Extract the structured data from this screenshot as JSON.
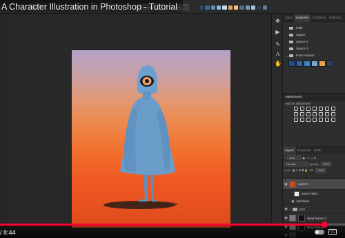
{
  "video": {
    "title": "A Character Illustration in Photoshop - Tutorial",
    "time": "/ 8:44",
    "progress_fraction": 0.94,
    "progress_color": "#ff0033"
  },
  "options_bar": {
    "mode": "Normal",
    "smoothing": "Smoothing",
    "angle": "0°",
    "swatch_colors": [
      "#2c4a6e",
      "#3d6b9a",
      "#5a8fc0",
      "#8db7d8",
      "#c8dbe8",
      "#e9a45b",
      "#f0c28a",
      "#4f6f8f",
      "#7a9bb8",
      "#a9c2d6",
      "#2f3e52",
      "#5d7f9e"
    ]
  },
  "tool_icons_right": [
    "move-icon",
    "play-icon",
    "brush-icon",
    "type-icon",
    "hand-icon"
  ],
  "swatches_panel": {
    "tabs": [
      "Color",
      "Swatches",
      "Gradients",
      "Patterns"
    ],
    "active_tab": "Swatches",
    "groups": [
      {
        "name": "Pale",
        "icon": "folder-icon"
      },
      {
        "name": "Space",
        "icon": "folder-icon"
      },
      {
        "name": "Space 2",
        "icon": "folder-icon"
      },
      {
        "name": "Space 3",
        "icon": "folder-icon"
      },
      {
        "name": "Post-Human",
        "icon": "folder-icon"
      }
    ],
    "post_human_colors": [
      "#1f4f8c",
      "#2a65ad",
      "#3b86c8",
      "#6aa9d8",
      "#e9a14c",
      "#2b3f66"
    ]
  },
  "adjustments_panel": {
    "title": "Adjustments",
    "subtitle": "Add an adjustment"
  },
  "layers_panel": {
    "tabs": [
      "Layers",
      "Channels",
      "Paths"
    ],
    "active_tab": "Layers",
    "filter": "Kind",
    "blend_mode": "Normal",
    "opacity_label": "Opacity:",
    "opacity": "100%",
    "lock_label": "Lock:",
    "fill_label": "Fill:",
    "fill": "100%",
    "layers": [
      {
        "name": "Layer 9",
        "eye": true,
        "thumb": "#c24a24",
        "selected": true
      },
      {
        "name": "Smart Filters",
        "eye": false,
        "thumb": "#ececec",
        "indent": true
      },
      {
        "name": "Add Noise",
        "eye": true,
        "thumb": "",
        "indent": true
      },
      {
        "name": "EYE",
        "eye": true,
        "thumb": "",
        "folder": true
      },
      {
        "name": "Head Texture 2",
        "eye": true,
        "thumb": "#777"
      },
      {
        "name": "Body Texture",
        "eye": true,
        "thumb": "#888"
      },
      {
        "name": "",
        "eye": true,
        "thumb": "#555"
      }
    ]
  }
}
